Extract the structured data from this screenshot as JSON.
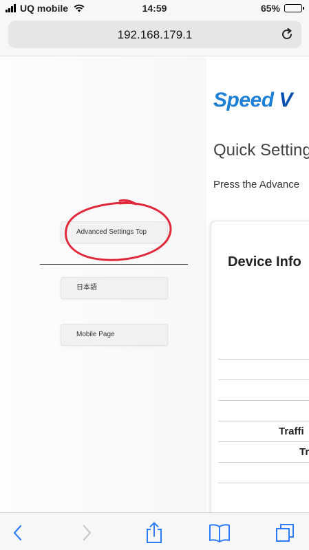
{
  "status_bar": {
    "carrier": "UQ mobile",
    "time": "14:59",
    "battery_percent": "65%",
    "battery_level": 0.65
  },
  "browser": {
    "url": "192.168.179.1"
  },
  "sidebar": {
    "buttons": [
      {
        "label": "Advanced Settings Top"
      },
      {
        "label": "日本語"
      },
      {
        "label": "Mobile Page"
      }
    ]
  },
  "main": {
    "logo": {
      "part1": "Speed ",
      "part2": "V"
    },
    "title": "Quick Setting",
    "instruction": "Press the Advance",
    "card": {
      "title": "Device Info",
      "rows": [
        {
          "label": "Traffi"
        },
        {
          "label": "Tr"
        }
      ]
    }
  },
  "colors": {
    "accent": "#1e7fd6",
    "annotation": "#e02a3c",
    "ios_blue": "#2f7cf6"
  }
}
